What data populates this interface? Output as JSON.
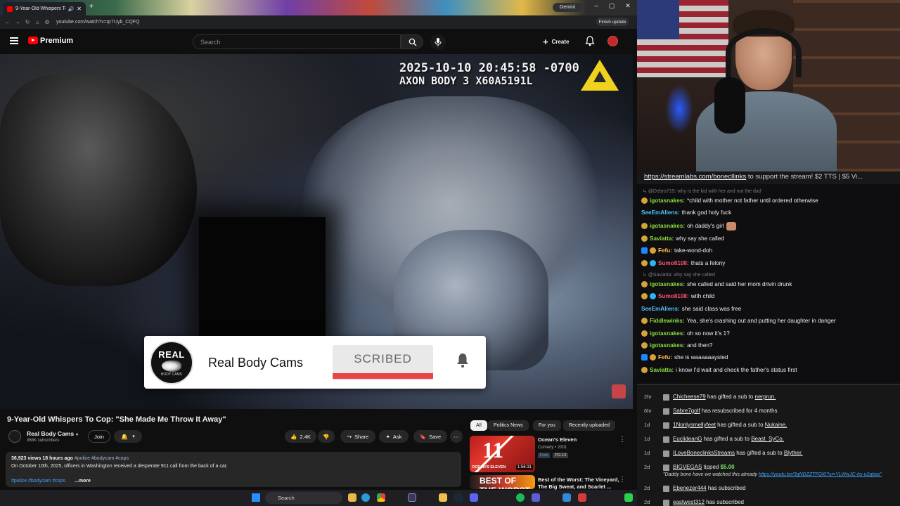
{
  "browser": {
    "tab_title": "9-Year-Old Whispers To Co...",
    "gemini_label": "Gemini",
    "url": "youtube.com/watch?v=qr7Uyb_CQFQ",
    "finish_update_label": "Finish update"
  },
  "yt_header": {
    "brand": "Premium",
    "search_placeholder": "Search",
    "create_label": "Create"
  },
  "video": {
    "timestamp_line1": "2025-10-10 20:45:58 -0700",
    "timestamp_line2": "AXON BODY 3 X60A5191L",
    "card": {
      "logo_top": "REAL",
      "logo_bottom": "BODY CAMS",
      "channel_name": "Real Body Cams",
      "subscribe_text": "SCRIBED"
    }
  },
  "watch": {
    "title": "9-Year-Old Whispers To Cop: \"She Made Me Throw It Away\"",
    "channel_name": "Real Body Cams",
    "channel_verified": "●",
    "subscribers": "368K subscribers",
    "join_label": "Join",
    "like_count": "2.4K",
    "share_label": "Share",
    "ask_label": "Ask",
    "save_label": "Save",
    "desc_meta": "36,923 views  18 hours ago",
    "desc_meta_tags": "#police #bodycam #cops",
    "desc_text": "On October 10th, 2025, officers in Washington received a desperate 911 call from the back of a car.",
    "desc_tags": "#police #bodycam #cops",
    "more_label": "...more"
  },
  "recs": {
    "chips": [
      "All",
      "Politics News",
      "For you",
      "Recently uploaded"
    ],
    "items": [
      {
        "title": "Ocean's Eleven",
        "sub": "Comedy • 2001",
        "free": "Free",
        "rating": "PG-13",
        "thumb_text": "11",
        "thumb_name": "OCEAN'S ELEVEN",
        "duration": "1:56:31"
      },
      {
        "title": "Best of the Worst: The Vineyard, The Big Sweat, and Scarlet ...",
        "thumb_text": "BEST OF THE WORST"
      }
    ]
  },
  "stream": {
    "banner": "https://streamlabs.com/bonecllinks",
    "banner_rest": " to support the stream! $2 TTS | $5 Vi...",
    "chat": [
      {
        "type": "reply",
        "text": "@Debra715: why is the kid with her and not the dad"
      },
      {
        "type": "msg",
        "user": "igotasnakes",
        "color": "#8bdc3f",
        "badges": [
          "gold"
        ],
        "text": "*child with mother not father until ordered otherwise"
      },
      {
        "type": "msg",
        "user": "SeeEmAliens",
        "color": "#4fc3f7",
        "badges": [],
        "text": "thank god holy fuck"
      },
      {
        "type": "msg",
        "user": "igotasnakes",
        "color": "#8bdc3f",
        "badges": [
          "gold"
        ],
        "text": "oh daddy's girl",
        "emote": true
      },
      {
        "type": "msg",
        "user": "Saviatta",
        "color": "#8bdc3f",
        "badges": [
          "gold"
        ],
        "text": "why say she called"
      },
      {
        "type": "msg",
        "user": "Fefu",
        "color": "#ffb74d",
        "badges": [
          "blue",
          "gold"
        ],
        "text": "take-wond-doh"
      },
      {
        "type": "msg",
        "user": "Sumo8108",
        "color": "#ff4f6d",
        "badges": [
          "gold",
          "cyan"
        ],
        "text": "thats a felony"
      },
      {
        "type": "reply",
        "text": "@Saviatta: why say she called"
      },
      {
        "type": "msg",
        "user": "igotasnakes",
        "color": "#8bdc3f",
        "badges": [
          "gold"
        ],
        "text": "she called and said her mom drivin drunk"
      },
      {
        "type": "msg",
        "user": "Sumo8108",
        "color": "#ff4f6d",
        "badges": [
          "gold",
          "cyan"
        ],
        "text": "with child"
      },
      {
        "type": "msg",
        "user": "SeeEmAliens",
        "color": "#4fc3f7",
        "badges": [],
        "text": "she said class was free"
      },
      {
        "type": "msg",
        "user": "Fiddlewinks",
        "color": "#8bdc3f",
        "badges": [
          "gold"
        ],
        "text": "Yea, she's crashing out and putting her daughter in danger"
      },
      {
        "type": "msg",
        "user": "igotasnakes",
        "color": "#8bdc3f",
        "badges": [
          "gold"
        ],
        "text": "oh so now it's 1?"
      },
      {
        "type": "msg",
        "user": "igotasnakes",
        "color": "#8bdc3f",
        "badges": [
          "gold"
        ],
        "text": "and then?"
      },
      {
        "type": "msg",
        "user": "Fefu",
        "color": "#ffb74d",
        "badges": [
          "blue",
          "gold"
        ],
        "text": "she is waaaaaaysted"
      },
      {
        "type": "msg",
        "user": "Saviatta",
        "color": "#8bdc3f",
        "badges": [
          "gold"
        ],
        "text": "i know I'd wait and check the father's status first"
      }
    ],
    "events": [
      {
        "time": "2hr",
        "name": "Chicheese79",
        "text": " has gifted a sub to ",
        "target": "nerprun."
      },
      {
        "time": "6hr",
        "name": "Sabre7golf",
        "text": " has resubscribed for 4 months",
        "target": ""
      },
      {
        "time": "1d",
        "name": "1Nonlysmellyfeet",
        "text": " has gifted a sub to ",
        "target": "Nukaine."
      },
      {
        "time": "1d",
        "name": "EuclideanG",
        "text": " has gifted a sub to ",
        "target": "Beast_SyCo."
      },
      {
        "time": "1d",
        "name": "ILoveBoneclinksStreams",
        "text": " has gifted a sub to ",
        "target": "Blyther."
      },
      {
        "time": "2d",
        "name": "BIGVEGAS",
        "text": " tipped ",
        "amount": "$5.00",
        "quote": "\"Daddy bone have we watched this already ",
        "quote_link": "https://youtu.be/3gNDZZTFGf0?si=YLWwJC-hs-o2gbas\""
      },
      {
        "time": "2d",
        "name": "Ebenezer444",
        "text": " has subscribed",
        "target": ""
      },
      {
        "time": "2d",
        "name": "eastwest312",
        "text": " has subscribed",
        "target": ""
      }
    ]
  },
  "taskbar": {
    "search_label": "Search"
  },
  "colors": {
    "yt_red": "#ff0000",
    "axon_yellow": "#f0d21e",
    "tip_green": "#7ee36f"
  }
}
